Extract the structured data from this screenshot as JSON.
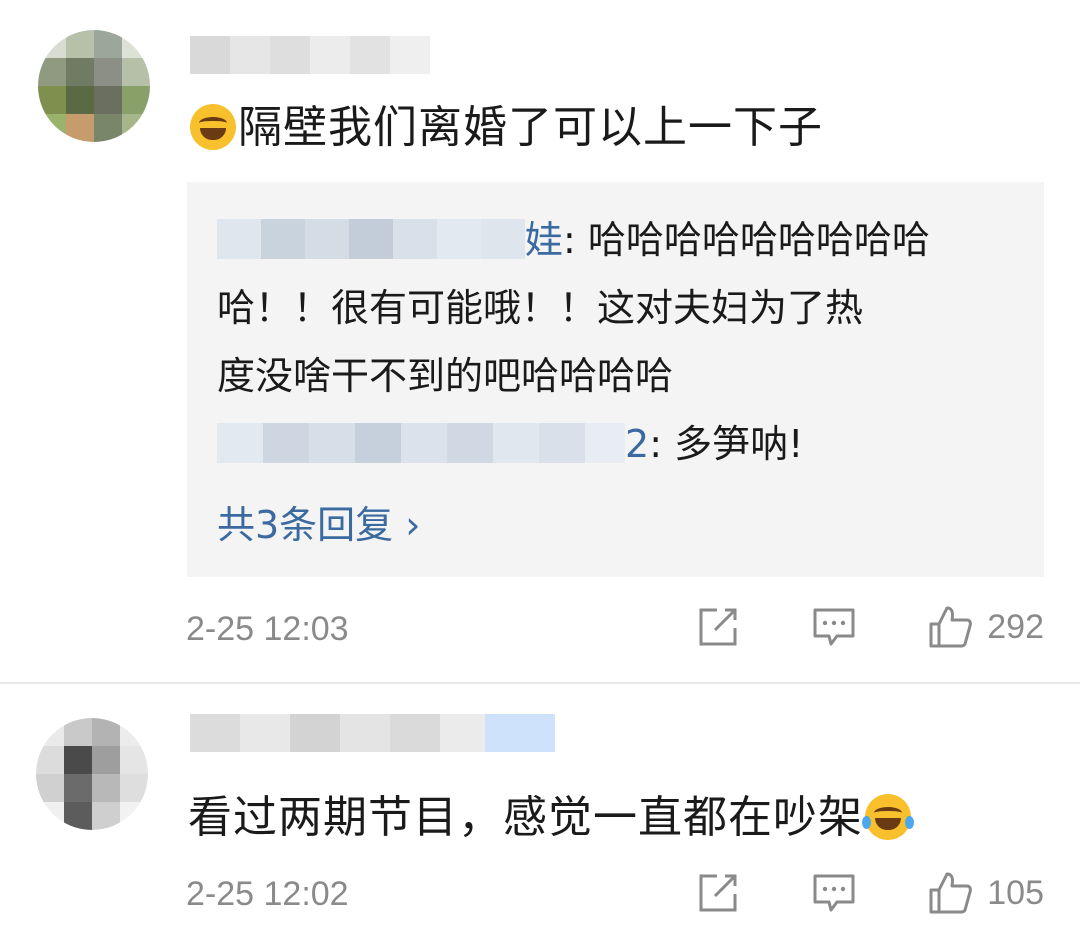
{
  "comments": [
    {
      "text": "隔壁我们离婚了可以上一下子",
      "replies": {
        "reply1_text_line1": ": 哈哈哈哈哈哈哈哈哈",
        "reply1_text_line2": "哈！！很有可能哦！！这对夫妇为了热",
        "reply1_text_line3": "度没啥干不到的吧哈哈哈哈",
        "reply1_name_tail": "娃",
        "reply2_name_tail": "2",
        "reply2_text": ": 多笋呐!",
        "more_label": "共3条回复",
        "more_chevron": "›"
      },
      "time": "2-25 12:03",
      "likes": "292"
    },
    {
      "text": "看过两期节目，感觉一直都在吵架",
      "time": "2-25 12:02",
      "likes": "105"
    }
  ],
  "icons": {
    "share": "share-icon",
    "comment": "comment-icon",
    "like": "thumbs-up-icon"
  },
  "colors": {
    "link": "#3b6aa0",
    "meta": "#8a8a8a",
    "reply_bg": "#f4f4f4"
  }
}
